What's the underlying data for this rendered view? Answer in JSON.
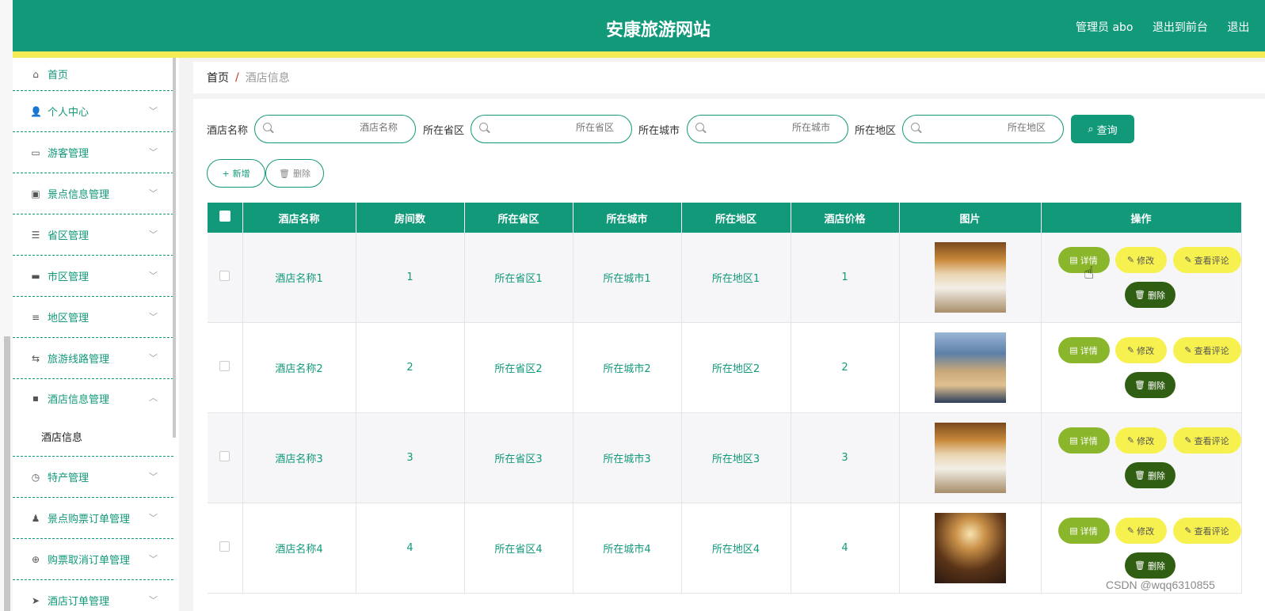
{
  "header": {
    "title": "安康旅游网站",
    "admin": "管理员 abo",
    "to_front": "退出到前台",
    "logout": "退出"
  },
  "sidebar": {
    "items": [
      {
        "label": "首页",
        "icon": "home-icon",
        "glyph": "⌂",
        "expanded": false
      },
      {
        "label": "个人中心",
        "icon": "user-icon",
        "glyph": "👤",
        "expanded": false
      },
      {
        "label": "游客管理",
        "icon": "id-card-icon",
        "glyph": "▭",
        "expanded": false
      },
      {
        "label": "景点信息管理",
        "icon": "clipboard-icon",
        "glyph": "▣",
        "expanded": false
      },
      {
        "label": "省区管理",
        "icon": "list-icon",
        "glyph": "☰",
        "expanded": false
      },
      {
        "label": "市区管理",
        "icon": "monitor-icon",
        "glyph": "▬",
        "expanded": false
      },
      {
        "label": "地区管理",
        "icon": "sliders-icon",
        "glyph": "≡",
        "expanded": false
      },
      {
        "label": "旅游线路管理",
        "icon": "route-icon",
        "glyph": "⇆",
        "expanded": false
      },
      {
        "label": "酒店信息管理",
        "icon": "message-icon",
        "glyph": "▪",
        "expanded": true
      },
      {
        "label": "特产管理",
        "icon": "clock-icon",
        "glyph": "◷",
        "expanded": false
      },
      {
        "label": "景点购票订单管理",
        "icon": "person-icon",
        "glyph": "♟",
        "expanded": false
      },
      {
        "label": "购票取消订单管理",
        "icon": "settings-icon",
        "glyph": "⊕",
        "expanded": false
      },
      {
        "label": "酒店订单管理",
        "icon": "send-icon",
        "glyph": "➤",
        "expanded": false
      }
    ],
    "sub_item": "酒店信息"
  },
  "breadcrumb": {
    "home": "首页",
    "separator": "/",
    "current": "酒店信息"
  },
  "search": {
    "fields": [
      {
        "label": "酒店名称",
        "placeholder": "酒店名称"
      },
      {
        "label": "所在省区",
        "placeholder": "所在省区"
      },
      {
        "label": "所在城市",
        "placeholder": "所在城市"
      },
      {
        "label": "所在地区",
        "placeholder": "所在地区"
      }
    ],
    "query_button": "查询"
  },
  "actions": {
    "add": "新增",
    "delete": "删除"
  },
  "table": {
    "headers": [
      "酒店名称",
      "房间数",
      "所在省区",
      "所在城市",
      "所在地区",
      "酒店价格",
      "图片",
      "操作"
    ],
    "rows": [
      {
        "name": "酒店名称1",
        "rooms": "1",
        "province": "所在省区1",
        "city": "所在城市1",
        "area": "所在地区1",
        "price": "1",
        "image": "hotel-room-photo"
      },
      {
        "name": "酒店名称2",
        "rooms": "2",
        "province": "所在省区2",
        "city": "所在城市2",
        "area": "所在地区2",
        "price": "2",
        "image": "hotel-building-photo"
      },
      {
        "name": "酒店名称3",
        "rooms": "3",
        "province": "所在省区3",
        "city": "所在城市3",
        "area": "所在地区3",
        "price": "3",
        "image": "hotel-room-photo"
      },
      {
        "name": "酒店名称4",
        "rooms": "4",
        "province": "所在省区4",
        "city": "所在城市4",
        "area": "所在地区4",
        "price": "4",
        "image": "banquet-hall-photo"
      }
    ],
    "row_buttons": {
      "detail": "详情",
      "edit": "修改",
      "comments": "查看评论",
      "remove": "删除"
    }
  },
  "watermark": "CSDN @wqq6310855",
  "colors": {
    "primary": "#11997a",
    "yellow": "#f4ec57",
    "detail_btn": "#8ab62c",
    "edit_btn": "#f7f150",
    "remove_btn": "#305f14"
  }
}
